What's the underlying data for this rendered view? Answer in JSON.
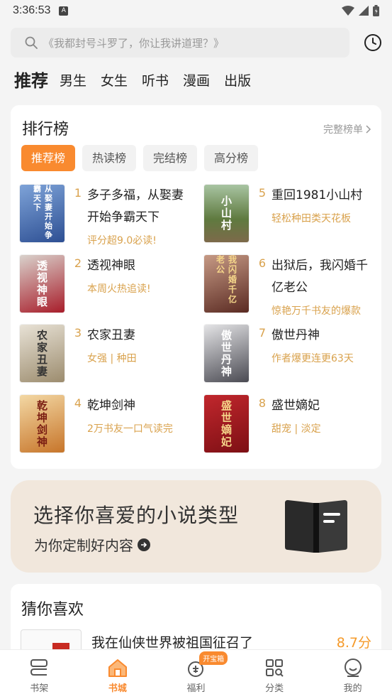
{
  "status": {
    "time": "3:36:53",
    "notif": "A"
  },
  "search": {
    "placeholder": "《我都封号斗罗了，你让我讲道理？》"
  },
  "nav_tabs": [
    "推荐",
    "男生",
    "女生",
    "听书",
    "漫画",
    "出版"
  ],
  "ranking": {
    "title": "排行榜",
    "more": "完整榜单",
    "tabs": [
      "推荐榜",
      "热读榜",
      "完结榜",
      "高分榜"
    ],
    "items": [
      {
        "rank": "1",
        "title": "多子多福，从娶妻开始争霸天下",
        "sub": "评分超9.0必读!",
        "cover": "从娶妻开始争霸天下",
        "color": "#3b5fa8"
      },
      {
        "rank": "2",
        "title": "透视神眼",
        "sub": "本周火热追读!",
        "cover": "透视神眼",
        "color": "#a81d2a"
      },
      {
        "rank": "3",
        "title": "农家丑妻",
        "sub": "女强 | 种田",
        "cover": "农家丑妻",
        "color": "#b9a98c"
      },
      {
        "rank": "4",
        "title": "乾坤剑神",
        "sub": "2万书友一口气读完",
        "cover": "乾坤剑神",
        "color": "#c7752a"
      },
      {
        "rank": "5",
        "title": "重回1981小山村",
        "sub": "轻松种田类天花板",
        "cover": "小山村",
        "color": "#5f7a3f"
      },
      {
        "rank": "6",
        "title": "出狱后，我闪婚千亿老公",
        "sub": "惊艳万千书友的爆款",
        "cover": "我闪婚千亿老公",
        "color": "#7a3b2b"
      },
      {
        "rank": "7",
        "title": "傲世丹神",
        "sub": "作者爆更连更63天",
        "cover": "傲世丹神",
        "color": "#4a4a52"
      },
      {
        "rank": "8",
        "title": "盛世嫡妃",
        "sub": "甜宠 | 淡定",
        "cover": "盛世嫡妃",
        "color": "#a3161d"
      }
    ]
  },
  "banner": {
    "title": "选择你喜爱的小说类型",
    "subtitle": "为你定制好内容"
  },
  "guess": {
    "title": "猜你喜欢",
    "book_title": "我在仙侠世界被祖国征召了",
    "score": "8.7分"
  },
  "bottom_nav": [
    {
      "label": "书架",
      "icon": "bookshelf-icon"
    },
    {
      "label": "书城",
      "icon": "home-icon",
      "active": true
    },
    {
      "label": "福利",
      "icon": "gift-icon",
      "badge": "开宝箱"
    },
    {
      "label": "分类",
      "icon": "category-icon"
    },
    {
      "label": "我的",
      "icon": "profile-icon"
    }
  ],
  "colors": {
    "accent": "#f98a2f",
    "gold": "#d9a24d",
    "score": "#f59a2a"
  }
}
